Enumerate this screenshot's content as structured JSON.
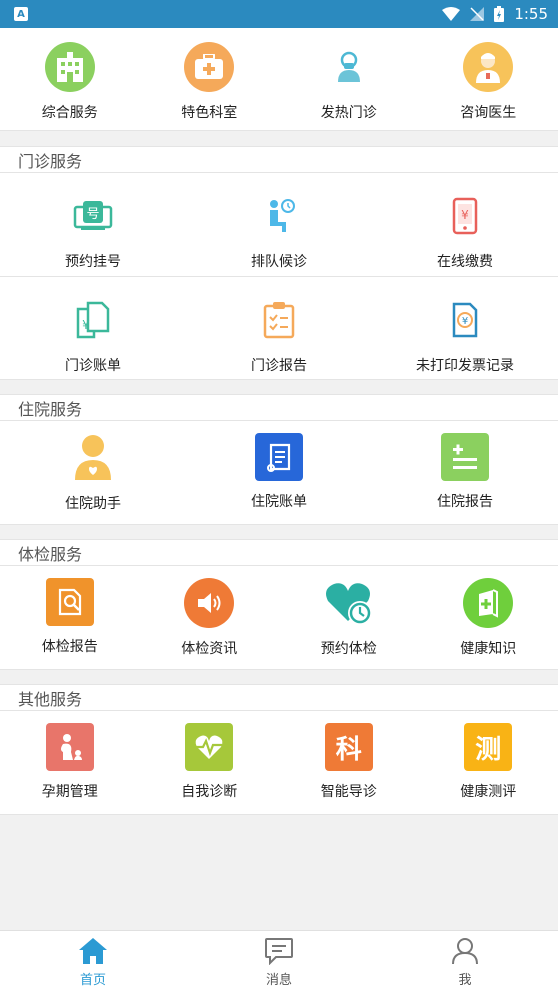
{
  "status_bar": {
    "time": "1:55",
    "app_badge": "A"
  },
  "top_services": [
    {
      "label": "综合服务",
      "icon": "hospital-building-icon",
      "color": "#8bd05f"
    },
    {
      "label": "特色科室",
      "icon": "medical-kit-icon",
      "color": "#f5a95a"
    },
    {
      "label": "发热门诊",
      "icon": "fever-clinic-icon",
      "color": "#6cc4d8"
    },
    {
      "label": "咨询医生",
      "icon": "doctor-icon",
      "color": "#f7c35a"
    }
  ],
  "outpatient": {
    "title": "门诊服务",
    "items": [
      {
        "label": "预约挂号",
        "icon": "registration-icon"
      },
      {
        "label": "排队候诊",
        "icon": "queue-wait-icon"
      },
      {
        "label": "在线缴费",
        "icon": "online-payment-icon"
      },
      {
        "label": "门诊账单",
        "icon": "outpatient-bill-icon"
      },
      {
        "label": "门诊报告",
        "icon": "outpatient-report-icon"
      },
      {
        "label": "未打印发票记录",
        "icon": "invoice-record-icon"
      }
    ]
  },
  "inpatient": {
    "title": "住院服务",
    "items": [
      {
        "label": "住院助手",
        "icon": "inpatient-assistant-icon"
      },
      {
        "label": "住院账单",
        "icon": "inpatient-bill-icon"
      },
      {
        "label": "住院报告",
        "icon": "inpatient-report-icon"
      }
    ]
  },
  "checkup": {
    "title": "体检服务",
    "items": [
      {
        "label": "体检报告",
        "icon": "checkup-report-icon"
      },
      {
        "label": "体检资讯",
        "icon": "checkup-news-icon"
      },
      {
        "label": "预约体检",
        "icon": "checkup-booking-icon"
      },
      {
        "label": "健康知识",
        "icon": "health-knowledge-icon"
      }
    ]
  },
  "other": {
    "title": "其他服务",
    "items": [
      {
        "label": "孕期管理",
        "icon": "pregnancy-icon",
        "glyph": ""
      },
      {
        "label": "自我诊断",
        "icon": "self-diagnosis-icon",
        "glyph": ""
      },
      {
        "label": "智能导诊",
        "icon": "smart-guide-icon",
        "glyph": "科"
      },
      {
        "label": "健康测评",
        "icon": "health-assessment-icon",
        "glyph": "测"
      }
    ]
  },
  "tabbar": {
    "tabs": [
      {
        "label": "首页",
        "icon": "home-icon",
        "active": true
      },
      {
        "label": "消息",
        "icon": "message-icon",
        "active": false
      },
      {
        "label": "我",
        "icon": "profile-icon",
        "active": false
      }
    ]
  }
}
